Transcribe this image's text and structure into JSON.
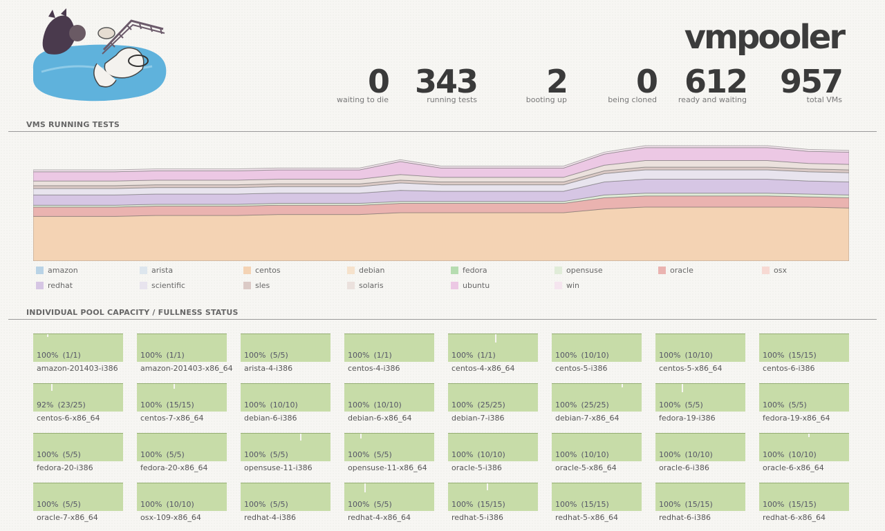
{
  "header": {
    "brand": "vmpooler",
    "logo_icon": "pool-creatures-illustration"
  },
  "stats": [
    {
      "value": "0",
      "label": "waiting to die"
    },
    {
      "value": "343",
      "label": "running tests"
    },
    {
      "value": "2",
      "label": "booting up"
    },
    {
      "value": "0",
      "label": "being cloned"
    },
    {
      "value": "612",
      "label": "ready and waiting"
    },
    {
      "value": "957",
      "label": "total VMs"
    }
  ],
  "sections": {
    "running_tests": "VMS RUNNING TESTS",
    "pool_status": "INDIVIDUAL POOL CAPACITY / FULLNESS STATUS"
  },
  "legend": [
    {
      "label": "amazon",
      "color": "#b9d3e6"
    },
    {
      "label": "arista",
      "color": "#dde6ee"
    },
    {
      "label": "centos",
      "color": "#f4d3b4"
    },
    {
      "label": "debian",
      "color": "#f6e2cc"
    },
    {
      "label": "fedora",
      "color": "#b6dcb0"
    },
    {
      "label": "opensuse",
      "color": "#e0ecd8"
    },
    {
      "label": "oracle",
      "color": "#eab3b0"
    },
    {
      "label": "osx",
      "color": "#f7d9d3"
    },
    {
      "label": "redhat",
      "color": "#d6c6e4"
    },
    {
      "label": "scientific",
      "color": "#e8e4ee"
    },
    {
      "label": "sles",
      "color": "#dbcac6"
    },
    {
      "label": "solaris",
      "color": "#ebe1dd"
    },
    {
      "label": "ubuntu",
      "color": "#ecc8e4"
    },
    {
      "label": "win",
      "color": "#f5e5ef"
    }
  ],
  "chart_data": {
    "type": "area",
    "title": "VMS RUNNING TESTS",
    "stacked": true,
    "x": [
      0,
      1,
      2,
      3,
      4,
      5,
      6,
      7,
      8,
      9,
      10,
      11,
      12,
      13,
      14,
      15,
      16,
      17,
      18,
      19,
      20
    ],
    "series": [
      {
        "name": "centos",
        "values": [
          48,
          48,
          48,
          49,
          49,
          49,
          50,
          50,
          50,
          52,
          52,
          52,
          52,
          52,
          56,
          58,
          58,
          58,
          58,
          58,
          57
        ]
      },
      {
        "name": "oracle",
        "values": [
          10,
          10,
          10,
          10,
          10,
          10,
          10,
          10,
          10,
          10,
          10,
          10,
          10,
          10,
          12,
          12,
          12,
          12,
          12,
          11,
          11
        ]
      },
      {
        "name": "opensuse",
        "values": [
          2,
          2,
          2,
          2,
          2,
          2,
          2,
          2,
          2,
          2,
          2,
          2,
          2,
          2,
          3,
          3,
          3,
          3,
          3,
          3,
          3
        ]
      },
      {
        "name": "redhat",
        "values": [
          11,
          11,
          11,
          11,
          11,
          11,
          11,
          11,
          11,
          12,
          11,
          11,
          11,
          11,
          14,
          15,
          15,
          15,
          15,
          14,
          14
        ]
      },
      {
        "name": "scientific",
        "values": [
          7,
          7,
          7,
          7,
          7,
          7,
          7,
          7,
          7,
          8,
          7,
          7,
          7,
          7,
          9,
          10,
          10,
          10,
          10,
          10,
          10
        ]
      },
      {
        "name": "sles",
        "values": [
          3,
          3,
          3,
          3,
          3,
          3,
          3,
          3,
          3,
          3,
          3,
          3,
          3,
          3,
          3,
          3,
          3,
          3,
          3,
          3,
          3
        ]
      },
      {
        "name": "solaris",
        "values": [
          5,
          5,
          5,
          5,
          5,
          5,
          5,
          5,
          5,
          6,
          5,
          5,
          5,
          5,
          6,
          7,
          7,
          7,
          7,
          6,
          6
        ]
      },
      {
        "name": "ubuntu",
        "values": [
          10,
          10,
          10,
          10,
          10,
          10,
          10,
          10,
          10,
          14,
          10,
          10,
          10,
          10,
          12,
          14,
          14,
          14,
          14,
          13,
          13
        ]
      },
      {
        "name": "win",
        "values": [
          2,
          2,
          2,
          2,
          2,
          2,
          2,
          2,
          2,
          2,
          2,
          2,
          2,
          2,
          2,
          2,
          2,
          2,
          2,
          2,
          2
        ]
      }
    ]
  },
  "pools": [
    {
      "name": "amazon-201403-i386",
      "pct": "100%",
      "count": "(1/1)"
    },
    {
      "name": "amazon-201403-x86_64",
      "pct": "100%",
      "count": "(1/1)"
    },
    {
      "name": "arista-4-i386",
      "pct": "100%",
      "count": "(5/5)"
    },
    {
      "name": "centos-4-i386",
      "pct": "100%",
      "count": "(1/1)"
    },
    {
      "name": "centos-4-x86_64",
      "pct": "100%",
      "count": "(1/1)"
    },
    {
      "name": "centos-5-i386",
      "pct": "100%",
      "count": "(10/10)"
    },
    {
      "name": "centos-5-x86_64",
      "pct": "100%",
      "count": "(10/10)"
    },
    {
      "name": "centos-6-i386",
      "pct": "100%",
      "count": "(15/15)"
    },
    {
      "name": "centos-6-x86_64",
      "pct": "92%",
      "count": "(23/25)"
    },
    {
      "name": "centos-7-x86_64",
      "pct": "100%",
      "count": "(15/15)"
    },
    {
      "name": "debian-6-i386",
      "pct": "100%",
      "count": "(10/10)"
    },
    {
      "name": "debian-6-x86_64",
      "pct": "100%",
      "count": "(10/10)"
    },
    {
      "name": "debian-7-i386",
      "pct": "100%",
      "count": "(25/25)"
    },
    {
      "name": "debian-7-x86_64",
      "pct": "100%",
      "count": "(25/25)"
    },
    {
      "name": "fedora-19-i386",
      "pct": "100%",
      "count": "(5/5)"
    },
    {
      "name": "fedora-19-x86_64",
      "pct": "100%",
      "count": "(5/5)"
    },
    {
      "name": "fedora-20-i386",
      "pct": "100%",
      "count": "(5/5)"
    },
    {
      "name": "fedora-20-x86_64",
      "pct": "100%",
      "count": "(5/5)"
    },
    {
      "name": "opensuse-11-i386",
      "pct": "100%",
      "count": "(5/5)"
    },
    {
      "name": "opensuse-11-x86_64",
      "pct": "100%",
      "count": "(5/5)"
    },
    {
      "name": "oracle-5-i386",
      "pct": "100%",
      "count": "(10/10)"
    },
    {
      "name": "oracle-5-x86_64",
      "pct": "100%",
      "count": "(10/10)"
    },
    {
      "name": "oracle-6-i386",
      "pct": "100%",
      "count": "(10/10)"
    },
    {
      "name": "oracle-6-x86_64",
      "pct": "100%",
      "count": "(10/10)"
    },
    {
      "name": "oracle-7-x86_64",
      "pct": "100%",
      "count": "(5/5)"
    },
    {
      "name": "osx-109-x86_64",
      "pct": "100%",
      "count": "(10/10)"
    },
    {
      "name": "redhat-4-i386",
      "pct": "100%",
      "count": "(5/5)"
    },
    {
      "name": "redhat-4-x86_64",
      "pct": "100%",
      "count": "(5/5)"
    },
    {
      "name": "redhat-5-i386",
      "pct": "100%",
      "count": "(15/15)"
    },
    {
      "name": "redhat-5-x86_64",
      "pct": "100%",
      "count": "(15/15)"
    },
    {
      "name": "redhat-6-i386",
      "pct": "100%",
      "count": "(15/15)"
    },
    {
      "name": "redhat-6-x86_64",
      "pct": "100%",
      "count": "(15/15)"
    }
  ]
}
